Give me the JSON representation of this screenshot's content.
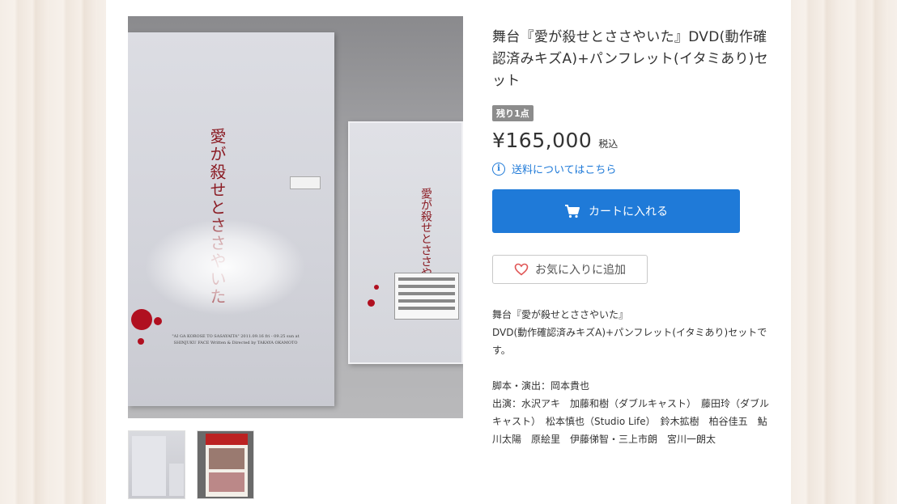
{
  "product": {
    "title": "舞台『愛が殺せとささやいた』DVD(動作確認済みキズA)+パンフレット(イタミあり)セット",
    "stock_badge": "残り1点",
    "price": "¥165,000",
    "tax_label": "税込",
    "shipping_link": "送料についてはこちら",
    "cart_button": "カートに入れる",
    "favorite_button": "お気に入りに追加",
    "description": [
      "舞台『愛が殺せとささやいた』",
      "DVD(動作確認済みキズA)+パンフレット(イタミあり)セットです。",
      "",
      "脚本・演出：岡本貴也",
      "出演：水沢アキ　加藤和樹（ダブルキャスト）　藤田玲（ダブルキャスト）　松本慎也（Studio Life）　鈴木拡樹　柏谷佳五　鮎川太陽　原絵里　伊藤俤智・三上市朗　宮川一朗太"
    ]
  },
  "photo": {
    "pamphlet_title": "愛が殺せとささやいた",
    "dvd_title": "愛が殺せとささやいた",
    "pamphlet_credits": "\"AI GA KOROSE TO SASAYAITA\" 2011.09.16 fri - 09.25 sun at SHINJUKU FACE Written & Directed by TAKAYA OKAMOTO"
  },
  "icons": {
    "info": "info-icon",
    "cart": "cart-icon",
    "heart": "heart-icon"
  },
  "colors": {
    "accent": "#1f7ad8",
    "badge": "#8c8c8c",
    "heart": "#e05555"
  }
}
